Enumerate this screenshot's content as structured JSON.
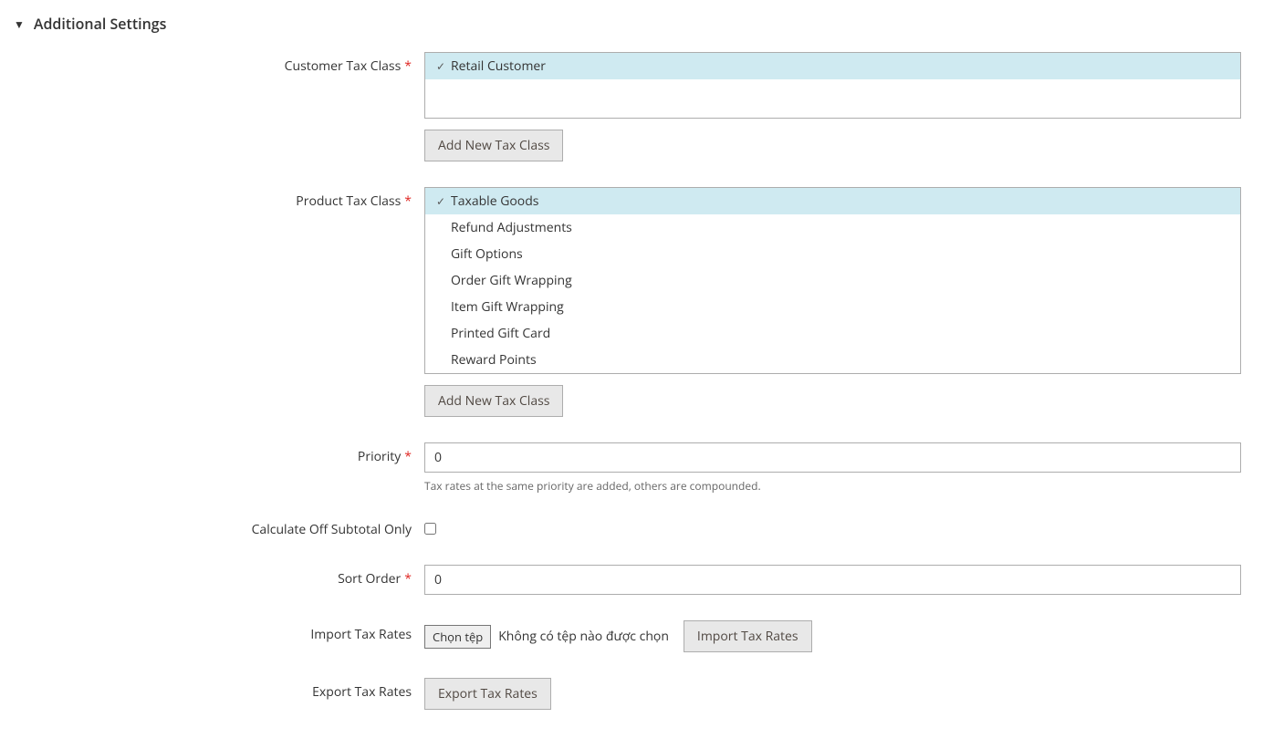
{
  "section": {
    "title": "Additional Settings"
  },
  "customerTaxClass": {
    "label": "Customer Tax Class",
    "items": [
      {
        "label": "Retail Customer",
        "selected": true
      }
    ],
    "addButton": "Add New Tax Class"
  },
  "productTaxClass": {
    "label": "Product Tax Class",
    "items": [
      {
        "label": "Taxable Goods",
        "selected": true
      },
      {
        "label": "Refund Adjustments",
        "selected": false
      },
      {
        "label": "Gift Options",
        "selected": false
      },
      {
        "label": "Order Gift Wrapping",
        "selected": false
      },
      {
        "label": "Item Gift Wrapping",
        "selected": false
      },
      {
        "label": "Printed Gift Card",
        "selected": false
      },
      {
        "label": "Reward Points",
        "selected": false
      }
    ],
    "addButton": "Add New Tax Class"
  },
  "priority": {
    "label": "Priority",
    "value": "0",
    "note": "Tax rates at the same priority are added, others are compounded."
  },
  "calculateSubtotal": {
    "label": "Calculate Off Subtotal Only"
  },
  "sortOrder": {
    "label": "Sort Order",
    "value": "0"
  },
  "importTaxRates": {
    "label": "Import Tax Rates",
    "chooseFile": "Chọn tệp",
    "noFileText": "Không có tệp nào được chọn",
    "importButton": "Import Tax Rates"
  },
  "exportTaxRates": {
    "label": "Export Tax Rates",
    "exportButton": "Export Tax Rates"
  }
}
